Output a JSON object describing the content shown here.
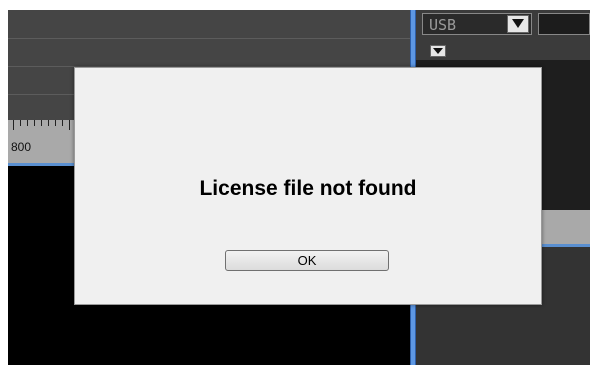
{
  "ruler": {
    "label": "800"
  },
  "right_panel": {
    "device_select_value": "USB"
  },
  "dialog": {
    "message": "License file not found",
    "ok_label": "OK"
  },
  "icons": {
    "device_dropdown": "chevron-down-icon",
    "panel_collapse": "chevron-down-icon"
  },
  "colors": {
    "splitter": "#5d97e3",
    "dialog_bg": "#f0f0f0",
    "panel_bg": "#000000"
  }
}
